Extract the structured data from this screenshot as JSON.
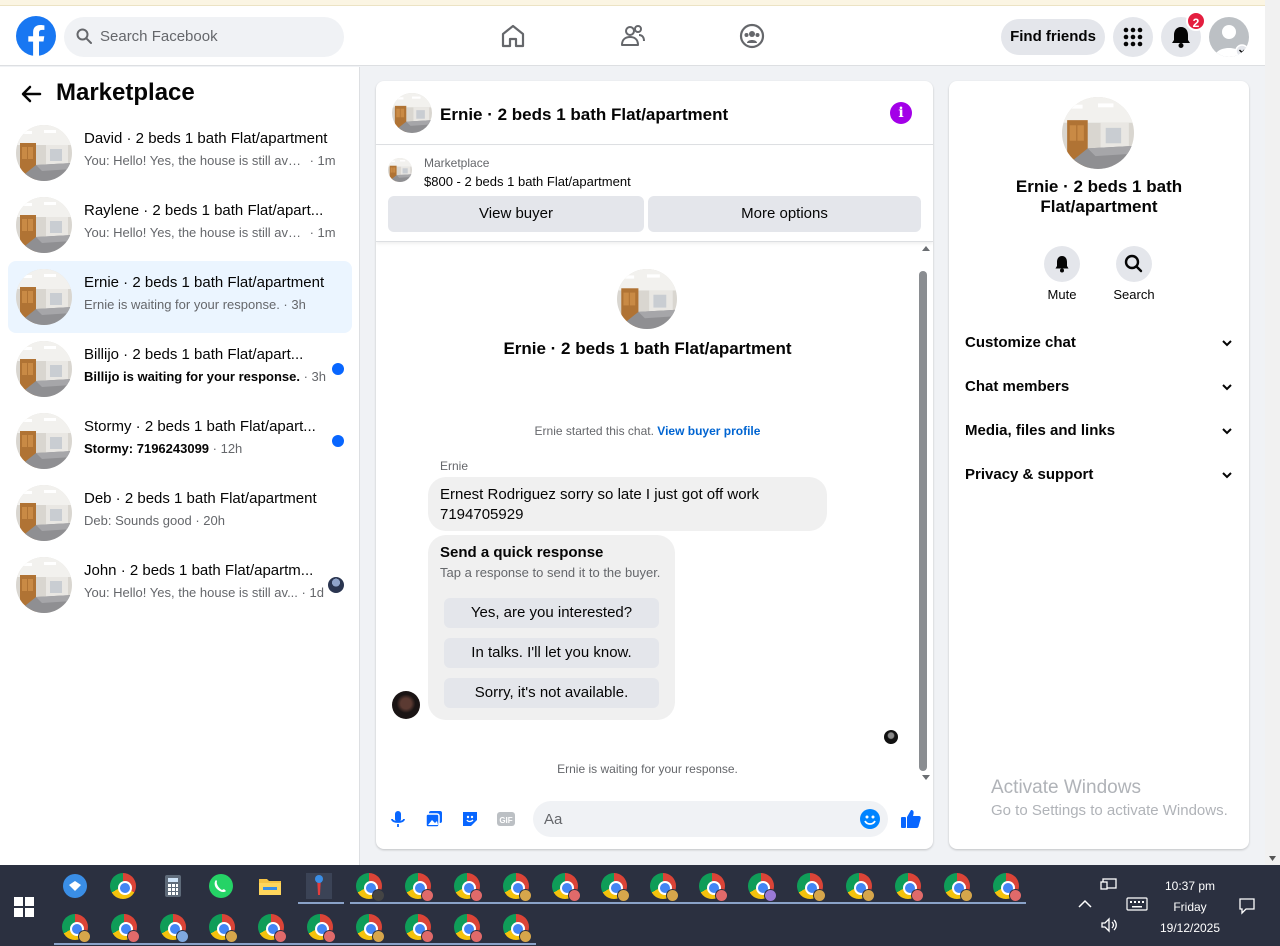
{
  "header": {
    "search_placeholder": "Search Facebook",
    "find_friends": "Find friends",
    "notification_count": "2"
  },
  "sidebar": {
    "title": "Marketplace",
    "conversations": [
      {
        "title": "David · 2 beds 1 bath Flat/apartment",
        "preview": "You: Hello! Yes, the house is still avail...",
        "time": " · 1m",
        "unread": false
      },
      {
        "title": "Raylene · 2 beds 1 bath Flat/apart...",
        "preview": "You: Hello! Yes, the house is still avail...",
        "time": " · 1m",
        "unread": false
      },
      {
        "title": "Ernie · 2 beds 1 bath Flat/apartment",
        "preview": "Ernie is waiting for your response.",
        "time": " · 3h",
        "unread": false,
        "active": true
      },
      {
        "title": "Billijo · 2 beds 1 bath Flat/apart...",
        "preview": "Billijo is waiting for your response.",
        "time": " · 3h",
        "unread": true
      },
      {
        "title": "Stormy · 2 beds 1 bath Flat/apart...",
        "preview": "Stormy: 7196243099",
        "time": " · 12h",
        "unread": true
      },
      {
        "title": "Deb · 2 beds 1 bath Flat/apartment",
        "preview": "Deb: Sounds good",
        "time": " · 20h",
        "unread": false
      },
      {
        "title": "John · 2 beds 1 bath Flat/apartm...",
        "preview": "You: Hello! Yes, the house is still av...",
        "time": " · 1d",
        "unread": false
      }
    ]
  },
  "chat": {
    "title": "Ernie · 2 beds 1 bath Flat/apartment",
    "marketplace_label": "Marketplace",
    "listing": "$800 - 2 beds 1 bath Flat/apartment",
    "view_buyer": "View buyer",
    "more_options": "More options",
    "center_title": "Ernie · 2 beds 1 bath Flat/apartment",
    "started_text": "Ernie started this chat.",
    "view_buyer_profile": "View buyer profile",
    "sender_name": "Ernie",
    "message": "Ernest Rodriguez sorry so late I just got off work 7194705929",
    "quick_title": "Send a quick response",
    "quick_subtitle": "Tap a response to send it to the buyer.",
    "quick_responses": [
      "Yes, are you interested?",
      "In talks. I'll let you know.",
      "Sorry, it's not available."
    ],
    "waiting": "Ernie is waiting for your response.",
    "composer_placeholder": "Aa"
  },
  "details": {
    "title": "Ernie · 2 beds 1 bath Flat/apartment",
    "mute": "Mute",
    "search": "Search",
    "sections": [
      "Customize chat",
      "Chat members",
      "Media, files and links",
      "Privacy & support"
    ]
  },
  "watermark": {
    "line1": "Activate Windows",
    "line2": "Go to Settings to activate Windows."
  },
  "taskbar": {
    "time": "10:37 pm",
    "day": "Friday",
    "date": "19/12/2025"
  },
  "colors": {
    "facebook_blue": "#1877f2",
    "messenger_blue": "#0866ff",
    "info_purple": "#a300e8",
    "active_row": "#ebf5ff"
  }
}
